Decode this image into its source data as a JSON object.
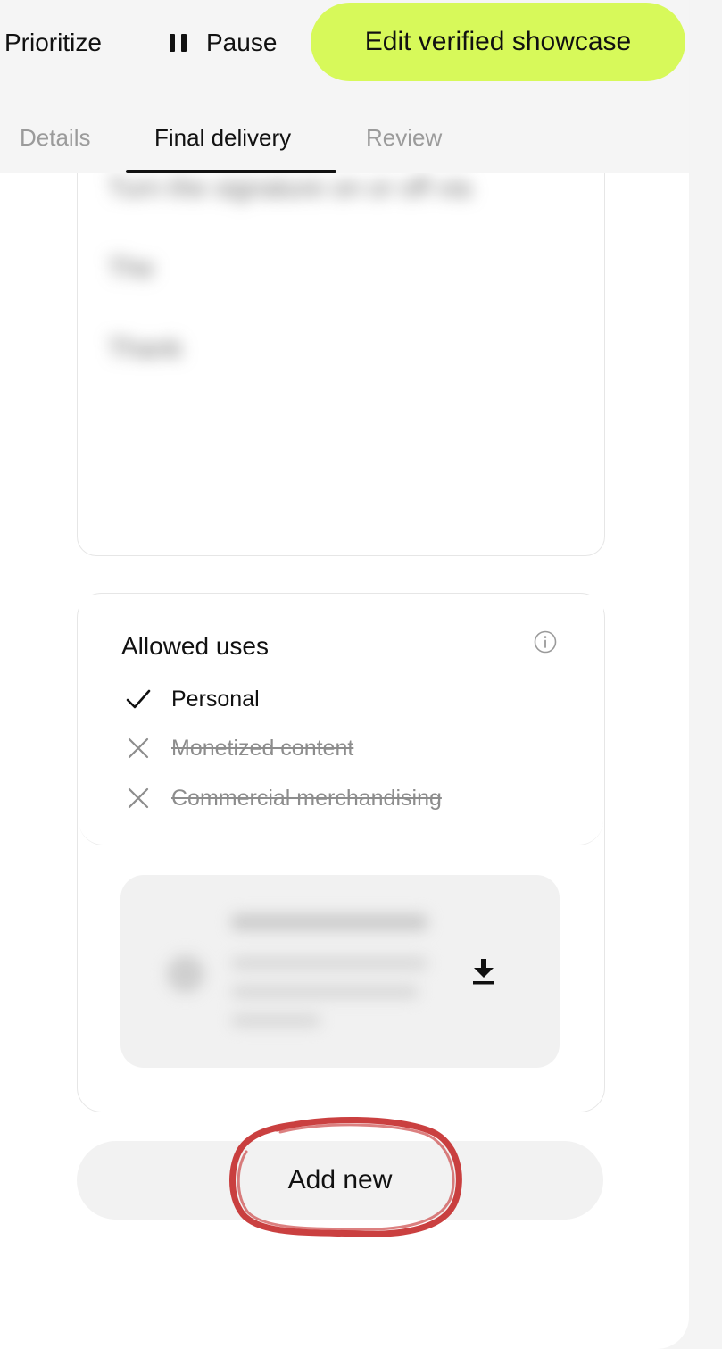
{
  "top_actions": {
    "prioritize": "Prioritize",
    "pause": "Pause",
    "edit_showcase": "Edit verified showcase"
  },
  "tabs": [
    {
      "label": "Details",
      "active": false
    },
    {
      "label": "Final delivery",
      "active": true
    },
    {
      "label": "Review",
      "active": false
    }
  ],
  "message": {
    "paragraphs": [
      "Turn the signature on or off via",
      "The",
      "Thank"
    ]
  },
  "allowed_uses": {
    "title": "Allowed uses",
    "items": [
      {
        "label": "Personal",
        "allowed": true
      },
      {
        "label": "Monetized content",
        "allowed": false
      },
      {
        "label": "Commercial merchandising",
        "allowed": false
      }
    ]
  },
  "file": {
    "icon": "download-icon"
  },
  "add_new": "Add new",
  "colors": {
    "accent": "#d7f95a",
    "annotation": "#c42b2b"
  }
}
